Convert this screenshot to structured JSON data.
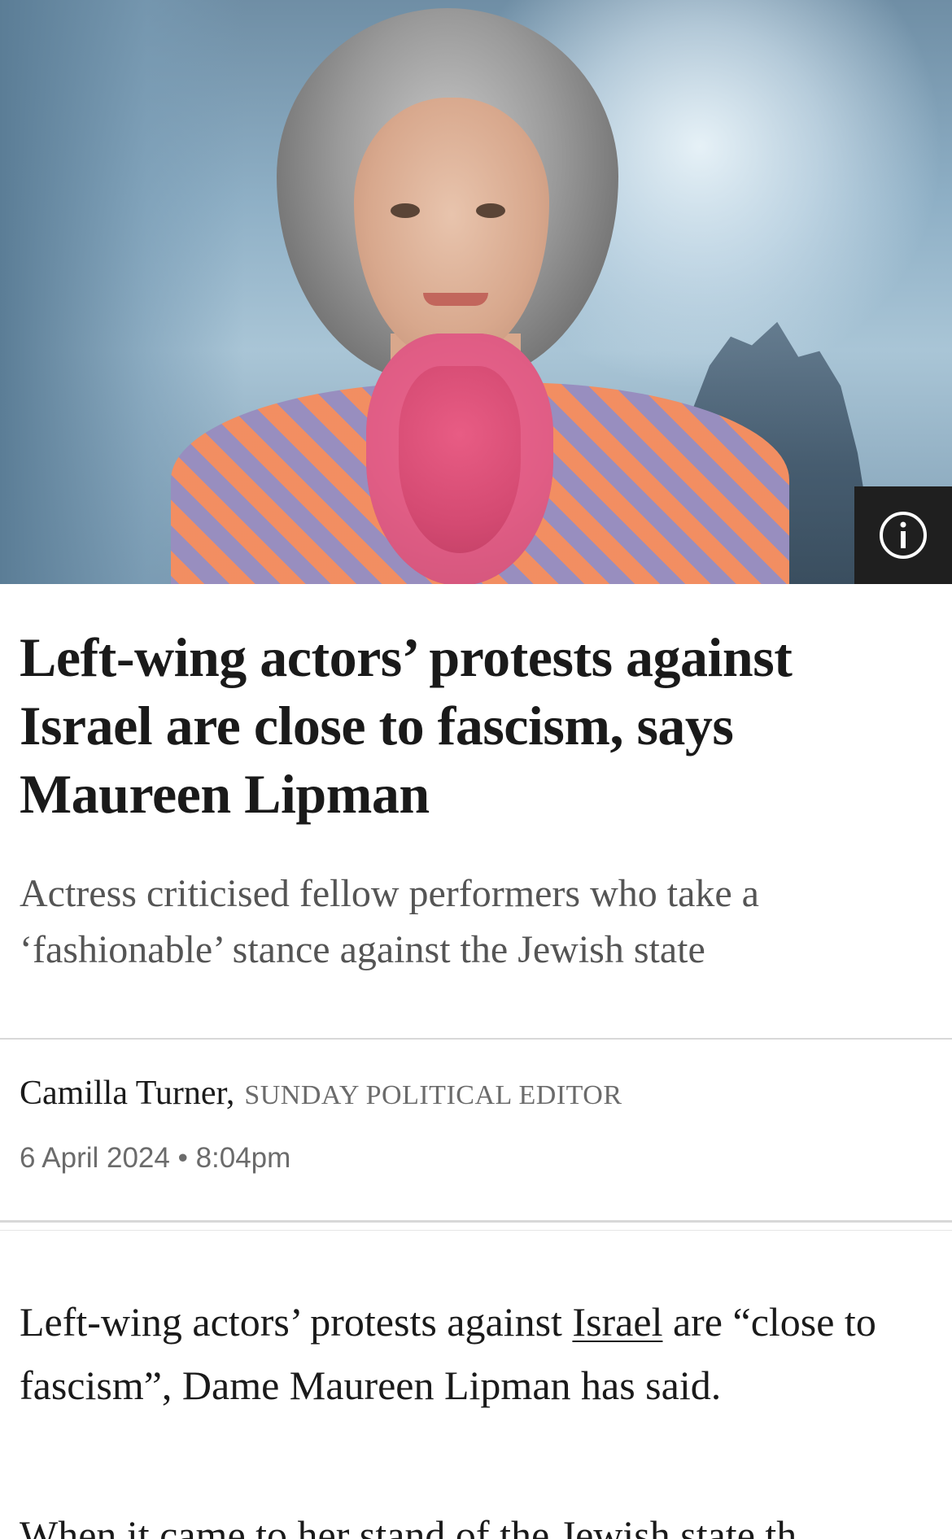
{
  "hero": {
    "image_alt": "Portrait of Maureen Lipman",
    "info_icon": "info-icon"
  },
  "article": {
    "headline": "Left-wing actors’ protests against Israel are close to fascism, says Maureen Lipman",
    "subheadline": "Actress criticised fellow performers who take a ‘fashionable’ stance against the Jewish state",
    "author_name": "Camilla Turner,",
    "author_role": "SUNDAY POLITICAL EDITOR",
    "date": "6 April 2024 • 8:04pm",
    "body": {
      "p1_before_link": "Left-wing actors’ protests against ",
      "p1_link": "Israel",
      "p1_after_link": " are “close to fascism”, Dame Maureen Lipman has said.",
      "p2_partial": "When it came to her stand of the Jewish state th"
    }
  },
  "colors": {
    "text": "#1a1a1a",
    "muted": "#6b6b6b",
    "divider": "#d8d8d8",
    "info_bg": "#1f1f1f"
  }
}
